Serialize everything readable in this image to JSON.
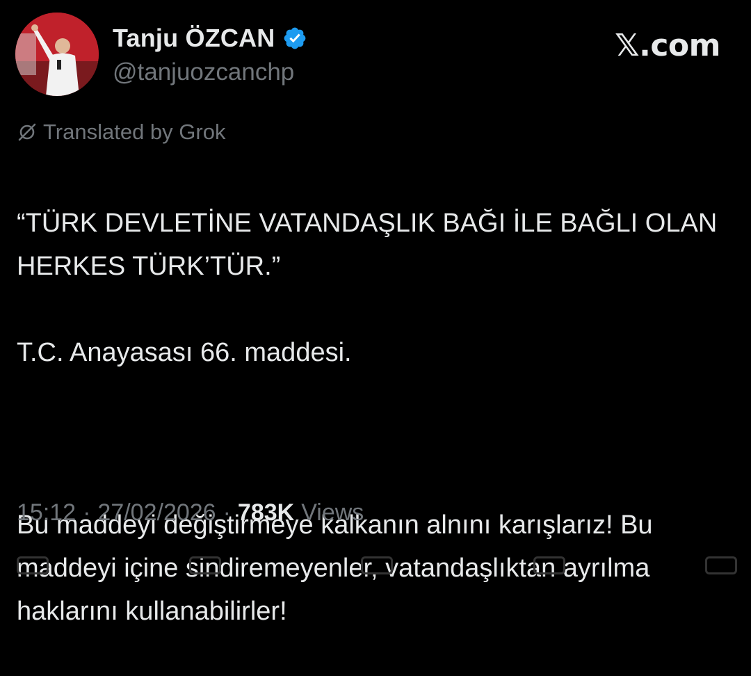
{
  "author": {
    "display_name": "Tanju ÖZCAN",
    "handle": "@tanjuozcanchp",
    "verified": true,
    "avatar_icon": "profile-photo"
  },
  "brand": {
    "logo_text": "𝕏.com"
  },
  "translation_notice": "Translated by Grok",
  "tweet": {
    "lines": [
      "“TÜRK DEVLETİNE VATANDAŞLIK BAĞI İLE BAĞLI OLAN HERKES TÜRK’TÜR.”",
      "T.C. Anayasası 66. maddesi.",
      "Bu maddeyi değiştirmeye kalkanın alnını karışlarız! Bu maddeyi içine sindiremeyenler, vatandaşlıktan ayrılma haklarını kullanabilirler!"
    ]
  },
  "meta": {
    "time": "15:12",
    "separator": "·",
    "date": "27/02/2026",
    "views_count": "783K",
    "views_label": "Views"
  },
  "colors": {
    "background": "#000000",
    "primary_text": "#e7e9ea",
    "secondary_text": "#71767b",
    "verified_blue": "#1d9bf0"
  }
}
